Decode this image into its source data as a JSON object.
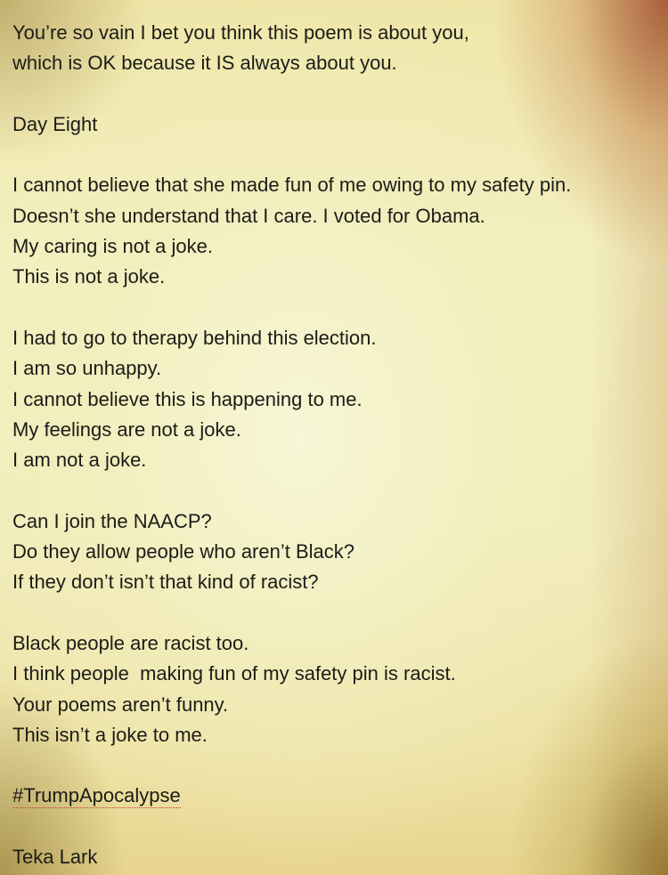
{
  "poem": {
    "intro": [
      "You’re so vain I bet you think this poem is about you,",
      "which is OK because it IS always about you."
    ],
    "day_heading": "Day Eight",
    "stanza1": [
      "I cannot believe that she made fun of me owing to my safety pin.",
      "Doesn’t she understand that I care. I voted for Obama.",
      "My caring is not a joke.",
      "This is not a joke."
    ],
    "stanza2": [
      "I had to go to therapy behind this election.",
      "I am so unhappy.",
      "I cannot believe this is happening to me.",
      "My feelings are not a joke.",
      "I am not a joke."
    ],
    "stanza3": [
      "Can I join the NAACP?",
      "Do they allow people who aren’t Black?",
      "If they don’t isn’t that kind of racist?"
    ],
    "stanza4": [
      "Black people are racist too.",
      "I think people  making fun of my safety pin is racist.",
      "Your poems aren’t funny.",
      "This isn’t a joke to me."
    ],
    "hashtag": "#TrumpApocalypse",
    "author": "Teka Lark"
  },
  "colors": {
    "text": "#1c1c18",
    "paper": "#f4efb4",
    "spellcheck_underline": "#c23a2a"
  }
}
